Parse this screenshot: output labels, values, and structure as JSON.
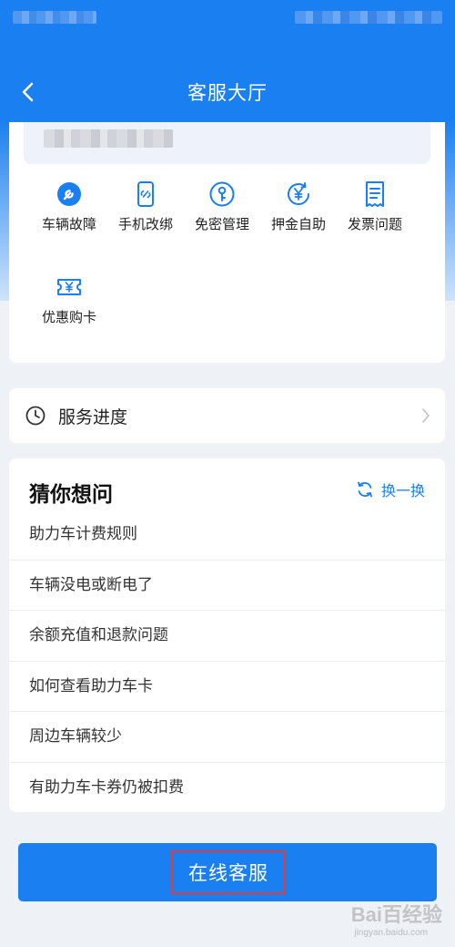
{
  "header": {
    "title": "客服大厅"
  },
  "tools": [
    {
      "label": "车辆故障",
      "icon": "wrench-icon"
    },
    {
      "label": "手机改绑",
      "icon": "phone-link-icon"
    },
    {
      "label": "免密管理",
      "icon": "key-icon"
    },
    {
      "label": "押金自助",
      "icon": "yen-refresh-icon"
    },
    {
      "label": "发票问题",
      "icon": "invoice-icon"
    },
    {
      "label": "优惠购卡",
      "icon": "coupon-card-icon"
    }
  ],
  "service_progress": {
    "label": "服务进度"
  },
  "faq": {
    "title": "猜你想问",
    "refresh_label": "换一换",
    "items": [
      "助力车计费规则",
      "车辆没电或断电了",
      "余额充值和退款问题",
      "如何查看助力车卡",
      "周边车辆较少",
      "有助力车卡券仍被扣费"
    ]
  },
  "online_service": {
    "label": "在线客服"
  },
  "watermark": {
    "main": "Bai百经验",
    "sub": "jingyan.baidu.com"
  },
  "colors": {
    "primary": "#1a7ff0",
    "highlight_box": "#e23b3b"
  }
}
